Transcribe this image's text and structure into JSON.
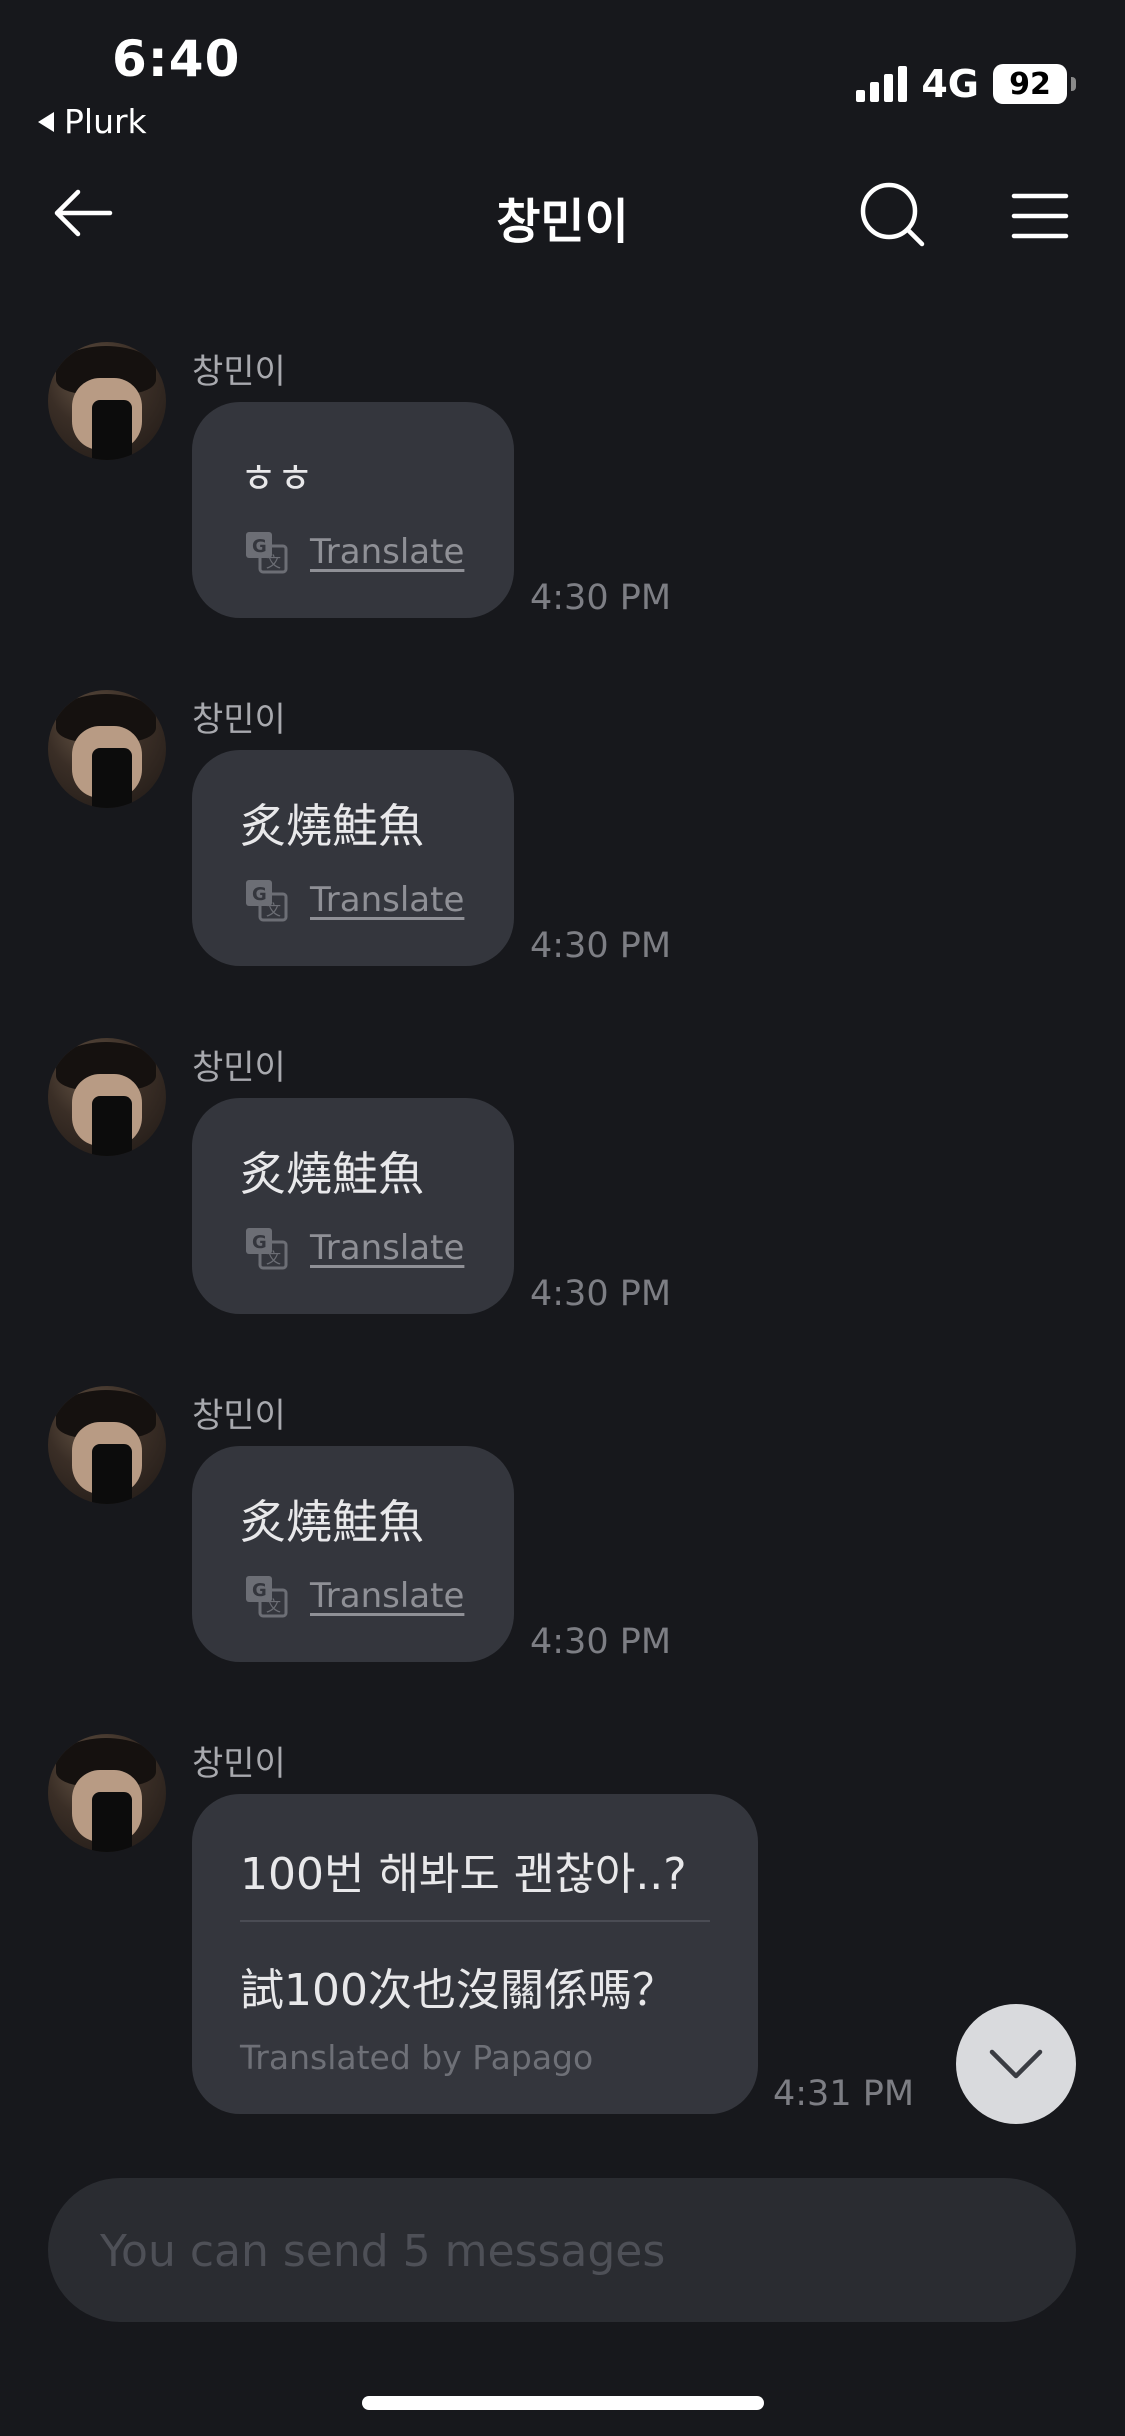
{
  "status_bar": {
    "time": "6:40",
    "back_app": "Plurk",
    "network": "4G",
    "battery": "92"
  },
  "header": {
    "title": "창민이"
  },
  "messages": [
    {
      "sender": "창민이",
      "text": "ㅎㅎ",
      "translate": "Translate",
      "time": "4:30 PM"
    },
    {
      "sender": "창민이",
      "text": "炙燒鮭魚",
      "translate": "Translate",
      "time": "4:30 PM"
    },
    {
      "sender": "창민이",
      "text": "炙燒鮭魚",
      "translate": "Translate",
      "time": "4:30 PM"
    },
    {
      "sender": "창민이",
      "text": "炙燒鮭魚",
      "translate": "Translate",
      "time": "4:30 PM"
    },
    {
      "sender": "창민이",
      "text": "100번 해봐도 괜찮아..?",
      "translation": "試100次也沒關係嗎？",
      "translated_by": "Translated by Papago",
      "time": "4:31 PM"
    }
  ],
  "composer": {
    "placeholder": "You can send 5 messages"
  },
  "icons": {
    "back": "arrow-left-icon",
    "search": "search-icon",
    "menu": "menu-icon",
    "translate": "translate-icon",
    "scroll_down": "chevron-down-icon"
  }
}
